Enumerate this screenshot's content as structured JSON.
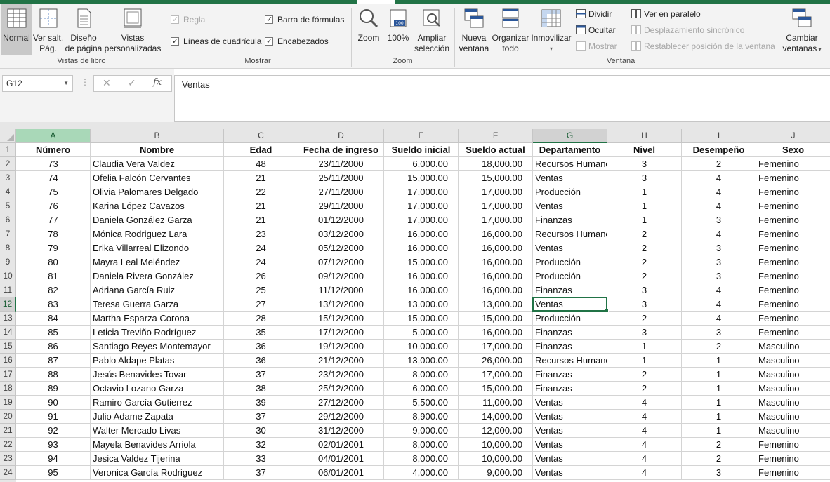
{
  "ribbon": {
    "views": {
      "group_label": "Vistas de libro",
      "normal": "Normal",
      "page_break_1": "Ver salt.",
      "page_break_2": "Pág.",
      "page_layout_1": "Diseño",
      "page_layout_2": "de página",
      "custom_1": "Vistas",
      "custom_2": "personalizadas"
    },
    "show": {
      "group_label": "Mostrar",
      "ruler": "Regla",
      "formula_bar": "Barra de fórmulas",
      "gridlines": "Líneas de cuadrícula",
      "headings": "Encabezados"
    },
    "zoom": {
      "group_label": "Zoom",
      "zoom": "Zoom",
      "hundred": "100%",
      "zoom_sel_1": "Ampliar",
      "zoom_sel_2": "selección"
    },
    "window": {
      "group_label": "Ventana",
      "new_1": "Nueva",
      "new_2": "ventana",
      "arrange_1": "Organizar",
      "arrange_2": "todo",
      "freeze": "Inmovilizar",
      "split": "Dividir",
      "hide": "Ocultar",
      "unhide": "Mostrar",
      "side_by_side": "Ver en paralelo",
      "sync_scroll": "Desplazamiento sincrónico",
      "reset_pos": "Restablecer posición de la ventana",
      "switch_1": "Cambiar",
      "switch_2": "ventanas"
    }
  },
  "formula_bar": {
    "name_box": "G12",
    "fx": "fx",
    "value": "Ventas"
  },
  "sheet": {
    "columns": [
      "A",
      "B",
      "C",
      "D",
      "E",
      "F",
      "G",
      "H",
      "I",
      "J"
    ],
    "header": [
      "Número",
      "Nombre",
      "Edad",
      "Fecha de ingreso",
      "Sueldo inicial",
      "Sueldo actual",
      "Departamento",
      "Nivel",
      "Desempeño",
      "Sexo"
    ],
    "rows": [
      [
        "73",
        "Claudia Vera Valdez",
        "48",
        "23/11/2000",
        "6,000.00",
        "18,000.00",
        "Recursos Humanos",
        "3",
        "2",
        "Femenino"
      ],
      [
        "74",
        "Ofelia Falcón Cervantes",
        "21",
        "25/11/2000",
        "15,000.00",
        "15,000.00",
        "Ventas",
        "3",
        "4",
        "Femenino"
      ],
      [
        "75",
        "Olivia Palomares Delgado",
        "22",
        "27/11/2000",
        "17,000.00",
        "17,000.00",
        "Producción",
        "1",
        "4",
        "Femenino"
      ],
      [
        "76",
        "Karina López Cavazos",
        "21",
        "29/11/2000",
        "17,000.00",
        "17,000.00",
        "Ventas",
        "1",
        "4",
        "Femenino"
      ],
      [
        "77",
        "Daniela González Garza",
        "21",
        "01/12/2000",
        "17,000.00",
        "17,000.00",
        "Finanzas",
        "1",
        "3",
        "Femenino"
      ],
      [
        "78",
        "Mónica Rodriguez Lara",
        "23",
        "03/12/2000",
        "16,000.00",
        "16,000.00",
        "Recursos Humanos",
        "2",
        "4",
        "Femenino"
      ],
      [
        "79",
        "Erika Villarreal Elizondo",
        "24",
        "05/12/2000",
        "16,000.00",
        "16,000.00",
        "Ventas",
        "2",
        "3",
        "Femenino"
      ],
      [
        "80",
        "Mayra Leal Meléndez",
        "24",
        "07/12/2000",
        "15,000.00",
        "16,000.00",
        "Producción",
        "2",
        "3",
        "Femenino"
      ],
      [
        "81",
        "Daniela Rivera González",
        "26",
        "09/12/2000",
        "16,000.00",
        "16,000.00",
        "Producción",
        "2",
        "3",
        "Femenino"
      ],
      [
        "82",
        "Adriana García Ruiz",
        "25",
        "11/12/2000",
        "16,000.00",
        "16,000.00",
        "Finanzas",
        "3",
        "4",
        "Femenino"
      ],
      [
        "83",
        "Teresa Guerra Garza",
        "27",
        "13/12/2000",
        "13,000.00",
        "13,000.00",
        "Ventas",
        "3",
        "4",
        "Femenino"
      ],
      [
        "84",
        "Martha Esparza Corona",
        "28",
        "15/12/2000",
        "15,000.00",
        "15,000.00",
        "Producción",
        "2",
        "4",
        "Femenino"
      ],
      [
        "85",
        "Leticia Treviño Rodríguez",
        "35",
        "17/12/2000",
        "5,000.00",
        "16,000.00",
        "Finanzas",
        "3",
        "3",
        "Femenino"
      ],
      [
        "86",
        "Santiago Reyes Montemayor",
        "36",
        "19/12/2000",
        "10,000.00",
        "17,000.00",
        "Finanzas",
        "1",
        "2",
        "Masculino"
      ],
      [
        "87",
        "Pablo Aldape Platas",
        "36",
        "21/12/2000",
        "13,000.00",
        "26,000.00",
        "Recursos Humanos",
        "1",
        "1",
        "Masculino"
      ],
      [
        "88",
        "Jesús Benavides Tovar",
        "37",
        "23/12/2000",
        "8,000.00",
        "17,000.00",
        "Finanzas",
        "2",
        "1",
        "Masculino"
      ],
      [
        "89",
        "Octavio Lozano Garza",
        "38",
        "25/12/2000",
        "6,000.00",
        "15,000.00",
        "Finanzas",
        "2",
        "1",
        "Masculino"
      ],
      [
        "90",
        "Ramiro García Gutierrez",
        "39",
        "27/12/2000",
        "5,500.00",
        "11,000.00",
        "Ventas",
        "4",
        "1",
        "Masculino"
      ],
      [
        "91",
        "Julio Adame Zapata",
        "37",
        "29/12/2000",
        "8,900.00",
        "14,000.00",
        "Ventas",
        "4",
        "1",
        "Masculino"
      ],
      [
        "92",
        "Walter Mercado Livas",
        "30",
        "31/12/2000",
        "9,000.00",
        "12,000.00",
        "Ventas",
        "4",
        "1",
        "Masculino"
      ],
      [
        "93",
        "Mayela Benavides Arriola",
        "32",
        "02/01/2001",
        "8,000.00",
        "10,000.00",
        "Ventas",
        "4",
        "2",
        "Femenino"
      ],
      [
        "94",
        "Jesica Valdez Tijerina",
        "33",
        "04/01/2001",
        "8,000.00",
        "10,000.00",
        "Ventas",
        "4",
        "2",
        "Femenino"
      ],
      [
        "95",
        "Veronica García Rodriguez",
        "37",
        "06/01/2001",
        "4,000.00",
        "9,000.00",
        "Ventas",
        "4",
        "3",
        "Femenino"
      ]
    ]
  },
  "colors": {
    "accent": "#217346",
    "selected_header": "#a9d8b8"
  }
}
